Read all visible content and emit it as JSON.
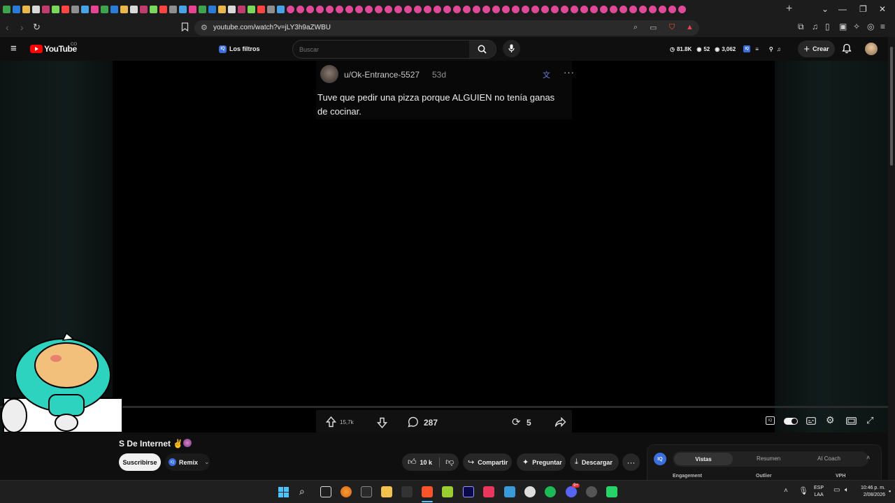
{
  "browser": {
    "tab_favicon_colors": [
      "#3ea34d",
      "#2b7bd8",
      "#e8b84a",
      "#d9d9d9",
      "#c23b6e",
      "#7ad85b",
      "#ff4444",
      "#8e8e8e",
      "#48a3e6",
      "#e84393"
    ],
    "url": "youtube.com/watch?v=jLY3h9aZWBU",
    "new_tab": "+",
    "window_buttons": [
      "⌄",
      "—",
      "❐",
      "✕"
    ]
  },
  "youtube": {
    "logo_text": "YouTube",
    "country_code": "CO",
    "filters_label": "Los filtros",
    "search_placeholder": "Buscar",
    "stats": {
      "views": "81.8K",
      "watching": "52",
      "views2": "3,062"
    },
    "create_label": "Crear"
  },
  "post": {
    "username": "u/Ok-Entrance-5527",
    "age": "53d",
    "text_line1": "Tuve que pedir una pizza porque ALGUIEN no tenía ganas",
    "text_line2": "de cocinar.",
    "upvotes": "15,7k",
    "comments": "287",
    "reposts": "5"
  },
  "channel": {
    "title": "S De Internet ✌",
    "subscribe_label": "Suscribirse",
    "remix_label": "Remix"
  },
  "actions": {
    "likes": "10 k",
    "share": "Compartir",
    "ask": "Preguntar",
    "download": "Descargar"
  },
  "iq_panel": {
    "badge": "IQ",
    "tabs": [
      "Vistas",
      "Resumen",
      "AI Coach"
    ],
    "columns": [
      "Engagement",
      "Outlier",
      "VPH"
    ]
  },
  "taskbar": {
    "lang_line1": "ESP",
    "lang_line2": "LAA",
    "time": "10:46 p. m.",
    "date": "2/08/2026",
    "discord_badge": "9+"
  }
}
